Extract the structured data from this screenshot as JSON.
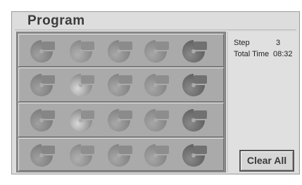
{
  "window": {
    "title": "Program"
  },
  "info": {
    "step_label": "Step",
    "step_value": "3",
    "total_time_label": "Total Time",
    "total_time_value": "08:32"
  },
  "buttons": {
    "clear_all_label": "Clear All"
  },
  "grid": {
    "rows": 4,
    "columns": 5,
    "slot_icon": "disc-track-icon"
  }
}
